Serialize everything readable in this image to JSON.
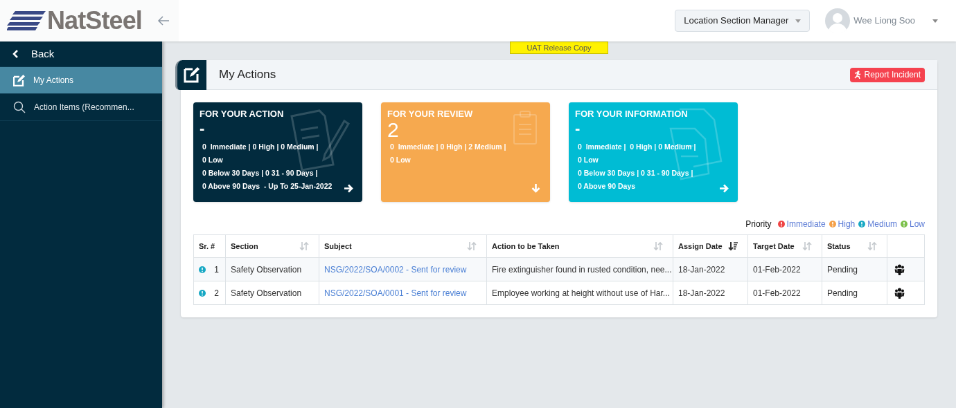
{
  "header": {
    "logo": "NatSteel",
    "role_selector": "Location Section Manager",
    "user_name": "Wee Liong Soo"
  },
  "sidebar": {
    "back": "Back",
    "items": [
      {
        "label": "My Actions",
        "kind": "edit",
        "selected": true
      },
      {
        "label": "Action Items (Recommen...",
        "kind": "search",
        "selected": false
      }
    ]
  },
  "banner": "UAT Release Copy",
  "panel": {
    "title": "My Actions",
    "report_button": "Report Incident"
  },
  "cards": [
    {
      "kind": "action",
      "title": "FOR YOUR ACTION",
      "value": "-",
      "lines": [
        "0  Immediate | 0 High | 0 Medium |",
        "0 Low",
        "0 Below 30 Days | 0 31 - 90 Days |",
        "0 Above 90 Days  - Up To 25-Jan-2022"
      ]
    },
    {
      "kind": "review",
      "title": "FOR YOUR REVIEW",
      "value": "2",
      "lines": [
        "0  Immediate | 0 High | 2 Medium |",
        "0 Low"
      ]
    },
    {
      "kind": "information",
      "title": "FOR YOUR INFORMATION",
      "value": "-",
      "lines": [
        "0  Immediate |  0 High | 0 Medium |",
        "0 Low",
        "0 Below 30 Days | 0 31 - 90 Days |",
        "0 Above 90 Days"
      ]
    }
  ],
  "priority_legend": {
    "label": "Priority",
    "items": [
      {
        "label": "Immediate",
        "color": "#ef4444"
      },
      {
        "label": "High",
        "color": "#f5a048"
      },
      {
        "label": "Medium",
        "color": "#17a8c4"
      },
      {
        "label": "Low",
        "color": "#7cc04b"
      }
    ]
  },
  "table": {
    "columns": [
      {
        "label": "Sr. #",
        "kind": "plain"
      },
      {
        "label": "Section",
        "kind": "sortable"
      },
      {
        "label": "Subject",
        "kind": "sortable"
      },
      {
        "label": "Action to be Taken",
        "kind": "sortable"
      },
      {
        "label": "Assign Date",
        "kind": "sorted"
      },
      {
        "label": "Target Date",
        "kind": "sortable"
      },
      {
        "label": "Status",
        "kind": "sortable"
      }
    ],
    "rows": [
      {
        "color": "#17a8c4",
        "sr": "1",
        "section": "Safety Observation",
        "subject": "NSG/2022/SOA/0002 - Sent for review",
        "action": "Fire extinguisher found in rusted condition, nee...",
        "assign_date": "18-Jan-2022",
        "target_date": "01-Feb-2022",
        "status": "Pending"
      },
      {
        "color": "#17a8c4",
        "sr": "2",
        "section": "Safety Observation",
        "subject": "NSG/2022/SOA/0001 - Sent for review",
        "action": "Employee working at height without use of Har...",
        "assign_date": "18-Jan-2022",
        "target_date": "01-Feb-2022",
        "status": "Pending"
      }
    ]
  }
}
